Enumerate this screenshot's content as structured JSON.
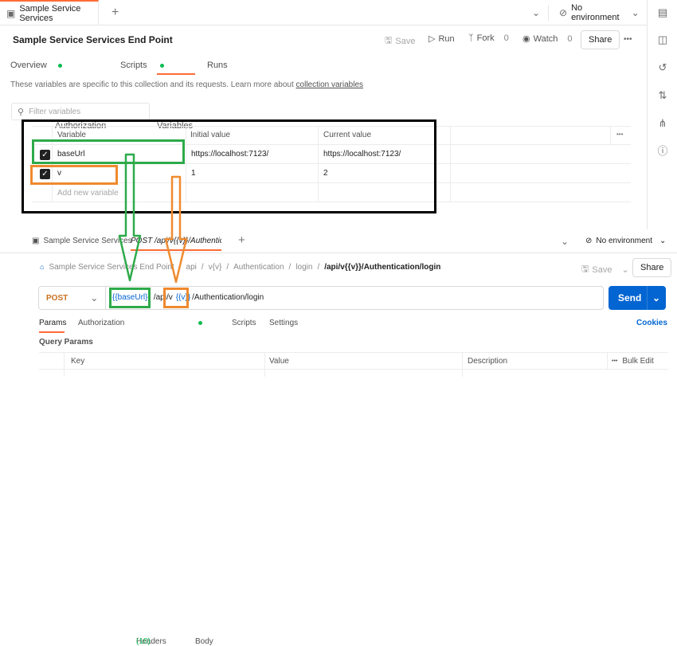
{
  "top_tabs": {
    "active_tab": "Sample Service Services",
    "add_label": "+",
    "environment": "No environment"
  },
  "collection": {
    "title": "Sample Service Services End Point",
    "actions": {
      "save": "Save",
      "run": "Run",
      "fork": "Fork",
      "fork_count": "0",
      "watch": "Watch",
      "watch_count": "0",
      "share": "Share"
    },
    "tabs": [
      "Overview",
      "Authorization",
      "Scripts",
      "Variables",
      "Runs"
    ],
    "active_tab": "Variables",
    "description": "These variables are specific to this collection and its requests. Learn more about",
    "description_link": "collection variables",
    "filter_placeholder": "Filter variables"
  },
  "variables": {
    "headers": [
      "Variable",
      "Initial value",
      "Current value"
    ],
    "rows": [
      {
        "name": "baseUrl",
        "initial": "https://localhost:7123/",
        "current": "https://localhost:7123/",
        "checked": true
      },
      {
        "name": "v",
        "initial": "1",
        "current": "2",
        "checked": true
      }
    ],
    "add_placeholder": "Add new variable",
    "more": "•••"
  },
  "request": {
    "tabs": {
      "collection_tab": "Sample Service Services",
      "request_tab": "POST /api/v{{v}}/Authentication",
      "add_label": "+",
      "environment": "No environment"
    },
    "breadcrumb": [
      "Sample Service Services End Point",
      "api",
      "v{v}",
      "Authentication",
      "login"
    ],
    "breadcrumb_title": "/api/v{{v}}/Authentication/login",
    "save": "Save",
    "share": "Share",
    "method": "POST",
    "url_parts": [
      "{{baseUrl}}",
      "/api/v",
      "{{v}}",
      "/Authentication/login"
    ],
    "send": "Send",
    "sub_tabs": [
      "Params",
      "Authorization",
      "Headers",
      "Body",
      "Scripts",
      "Settings"
    ],
    "headers_count": "(10)",
    "cookies": "Cookies",
    "query_params_title": "Query Params",
    "params_headers": [
      "Key",
      "Value",
      "Description"
    ],
    "bulk_edit": "Bulk Edit"
  },
  "colors": {
    "accent_orange": "#ff6c37",
    "send_blue": "#0265d2",
    "active_green": "#0cbb52",
    "annotation_black": "#000000",
    "annotation_green": "#2eaa4a",
    "annotation_orange": "#ef8a2e"
  },
  "icons": [
    "collection-icon",
    "add-icon",
    "chevron-down-icon",
    "no-environment-icon",
    "environment-quick-look-icon",
    "save-icon",
    "run-icon",
    "fork-icon",
    "watch-icon",
    "more-icon",
    "search-icon",
    "documentation-icon",
    "history-icon",
    "pull-request-icon",
    "fork-graph-icon",
    "info-icon"
  ]
}
